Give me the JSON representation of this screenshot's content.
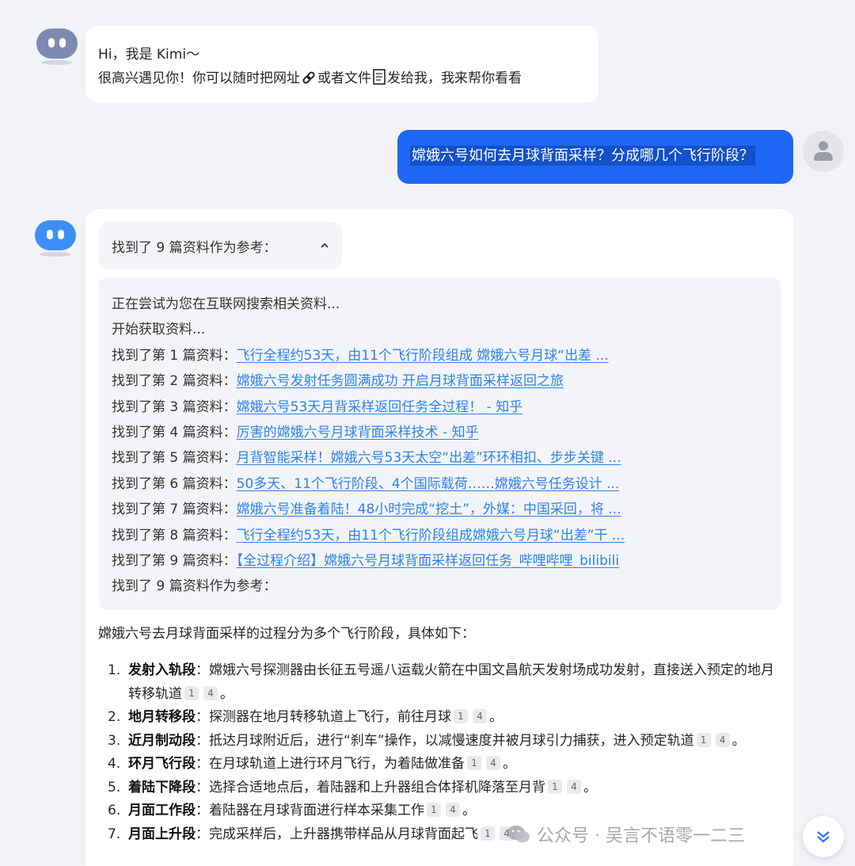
{
  "greeting": {
    "line1": "Hi，我是 Kimi～",
    "line2_a": "很高兴遇见你！你可以随时把网址",
    "line2_b": "或者文件",
    "line2_c": "发给我，我来帮你看看"
  },
  "user_message": "嫦娥六号如何去月球背面采样？分成哪几个飞行阶段？",
  "references": {
    "toggle_label": "找到了 9 篇资料作为参考：",
    "status_lines": [
      "正在尝试为您在互联网搜索相关资料...",
      "开始获取资料..."
    ],
    "items": [
      {
        "prefix": "找到了第 1 篇资料：",
        "title": "飞行全程约53天，由11个飞行阶段组成 嫦娥六号月球“出差 ..."
      },
      {
        "prefix": "找到了第 2 篇资料：",
        "title": "嫦娥六号发射任务圆满成功 开启月球背面采样返回之旅"
      },
      {
        "prefix": "找到了第 3 篇资料：",
        "title": "嫦娥六号53天月背采样返回任务全过程！ - 知乎"
      },
      {
        "prefix": "找到了第 4 篇资料：",
        "title": "厉害的嫦娥六号月球背面采样技术 - 知乎"
      },
      {
        "prefix": "找到了第 5 篇资料：",
        "title": "月背智能采样！嫦娥六号53天太空“出差”环环相扣、步步关键 ..."
      },
      {
        "prefix": "找到了第 6 篇资料：",
        "title": "50多天、11个飞行阶段、4个国际载荷……嫦娥六号任务设计 ..."
      },
      {
        "prefix": "找到了第 7 篇资料：",
        "title": "嫦娥六号准备着陆！48小时完成“挖土”，外媒：中国采回，将 ..."
      },
      {
        "prefix": "找到了第 8 篇资料：",
        "title": "飞行全程约53天，由11个飞行阶段组成嫦娥六号月球“出差”干 ..."
      },
      {
        "prefix": "找到了第 9 篇资料：",
        "title": "【全过程介绍】嫦娥六号月球背面采样返回任务_哔哩哔哩_bilibili"
      }
    ],
    "summary_line": "找到了 9 篇资料作为参考："
  },
  "answer": {
    "intro": "嫦娥六号去月球背面采样的过程分为多个飞行阶段，具体如下：",
    "steps": [
      {
        "num": "1.",
        "title": "发射入轨段",
        "text": "：嫦娥六号探测器由长征五号遥八运载火箭在中国文昌航天发射场成功发射，直接送入预定的地月转移轨道",
        "cites": [
          "1",
          "4"
        ],
        "end": "。"
      },
      {
        "num": "2.",
        "title": "地月转移段",
        "text": "：探测器在地月转移轨道上飞行，前往月球",
        "cites": [
          "1",
          "4"
        ],
        "end": "。"
      },
      {
        "num": "3.",
        "title": "近月制动段",
        "text": "：抵达月球附近后，进行“刹车”操作，以减慢速度并被月球引力捕获，进入预定轨道",
        "cites": [
          "1",
          "4"
        ],
        "end": "。"
      },
      {
        "num": "4.",
        "title": "环月飞行段",
        "text": "：在月球轨道上进行环月飞行，为着陆做准备",
        "cites": [
          "1",
          "4"
        ],
        "end": "。"
      },
      {
        "num": "5.",
        "title": "着陆下降段",
        "text": "：选择合适地点后，着陆器和上升器组合体择机降落至月背",
        "cites": [
          "1",
          "4"
        ],
        "end": "。"
      },
      {
        "num": "6.",
        "title": "月面工作段",
        "text": "：着陆器在月球背面进行样本采集工作",
        "cites": [
          "1",
          "4"
        ],
        "end": "。"
      },
      {
        "num": "7.",
        "title": "月面上升段",
        "text": "：完成采样后，上升器携带样品从月球背面起飞",
        "cites": [
          "1",
          "4"
        ],
        "end": "。"
      }
    ]
  },
  "watermark": "公众号 · 吴言不语零一二三",
  "colors": {
    "user_bubble": "#1f67f5",
    "link": "#2e82e8",
    "background": "#f2f3f7"
  }
}
